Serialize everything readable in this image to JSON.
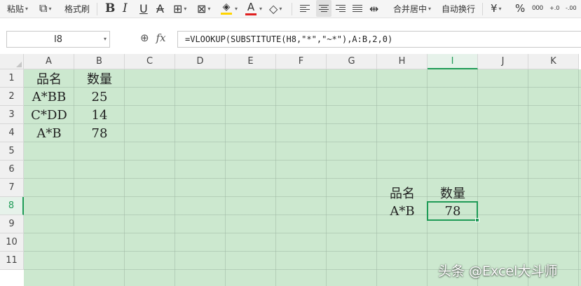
{
  "toolbar": {
    "paste": "粘贴",
    "format_painter": "格式刷",
    "bold": "B",
    "italic": "I",
    "underline": "U",
    "strikethrough": "A",
    "merge_center": "合并居中",
    "wrap_text": "自动换行",
    "currency": "¥",
    "percent": "%",
    "thousands": "000",
    "increase_decimal": "+.0",
    "decrease_decimal": "-.00",
    "font_color": "#e02020",
    "fill_color": "#ffd400"
  },
  "formula_bar": {
    "name_box": "I8",
    "formula": "=VLOOKUP(SUBSTITUTE(H8,\"*\",\"~*\"),A:B,2,0)"
  },
  "columns": [
    "A",
    "B",
    "C",
    "D",
    "E",
    "F",
    "G",
    "H",
    "I",
    "J",
    "K"
  ],
  "rows": [
    "1",
    "2",
    "3",
    "4",
    "5",
    "6",
    "7",
    "8",
    "9",
    "10",
    "11"
  ],
  "selected": {
    "column": "I",
    "row": "8"
  },
  "cells": {
    "A1": "品名",
    "B1": "数量",
    "A2": "A*BB",
    "B2": "25",
    "A3": "C*DD",
    "B3": "14",
    "A4": "A*B",
    "B4": "78",
    "H7": "品名",
    "I7": "数量",
    "H8": "A*B",
    "I8": "78"
  },
  "watermark": "头条 @Excel大斗师",
  "colors": {
    "sheet_bg": "#cce8cf",
    "selection": "#1f9b57"
  }
}
